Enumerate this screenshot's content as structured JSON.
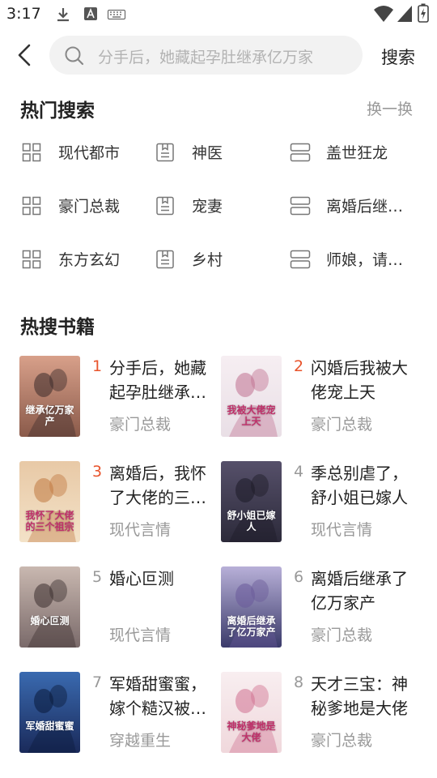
{
  "status": {
    "time": "3:17"
  },
  "search": {
    "placeholder": "分手后，她藏起孕肚继承亿万家",
    "button": "搜索"
  },
  "hot_search": {
    "title": "热门搜索",
    "refresh": "换一换",
    "items": [
      {
        "label": "现代都市",
        "icon": "grid-icon"
      },
      {
        "label": "神医",
        "icon": "book-icon"
      },
      {
        "label": "盖世狂龙",
        "icon": "list-icon"
      },
      {
        "label": "豪门总裁",
        "icon": "grid-icon"
      },
      {
        "label": "宠妻",
        "icon": "book-icon"
      },
      {
        "label": "离婚后继…",
        "icon": "list-icon"
      },
      {
        "label": "东方玄幻",
        "icon": "grid-icon"
      },
      {
        "label": "乡村",
        "icon": "book-icon"
      },
      {
        "label": "师娘，请…",
        "icon": "list-icon"
      }
    ]
  },
  "hot_books": {
    "title": "热搜书籍",
    "items": [
      {
        "rank": "1",
        "title": "分手后，她藏起孕肚继承…",
        "category": "豪门总裁",
        "cover_title": "继承亿万家产"
      },
      {
        "rank": "2",
        "title": "闪婚后我被大佬宠上天",
        "category": "豪门总裁",
        "cover_title": "我被大佬宠上天"
      },
      {
        "rank": "3",
        "title": "离婚后，我怀了大佬的三…",
        "category": "现代言情",
        "cover_title": "我怀了大佬的三个祖宗"
      },
      {
        "rank": "4",
        "title": "季总别虐了，舒小姐已嫁人",
        "category": "现代言情",
        "cover_title": "舒小姐已嫁人"
      },
      {
        "rank": "5",
        "title": "婚心叵测",
        "category": "现代言情",
        "cover_title": "婚心叵测"
      },
      {
        "rank": "6",
        "title": "离婚后继承了亿万家产",
        "category": "豪门总裁",
        "cover_title": "离婚后继承了亿万家产"
      },
      {
        "rank": "7",
        "title": "军婚甜蜜蜜，嫁个糙汉被…",
        "category": "穿越重生",
        "cover_title": "军婚甜蜜蜜"
      },
      {
        "rank": "8",
        "title": "天才三宝：神秘爹地是大佬",
        "category": "豪门总裁",
        "cover_title": "神秘爹地是大佬"
      }
    ]
  },
  "colors": {
    "rank_top": "#e8542c",
    "rank_other": "#999999",
    "muted": "#999999",
    "search_bg": "#f2f2f2"
  }
}
